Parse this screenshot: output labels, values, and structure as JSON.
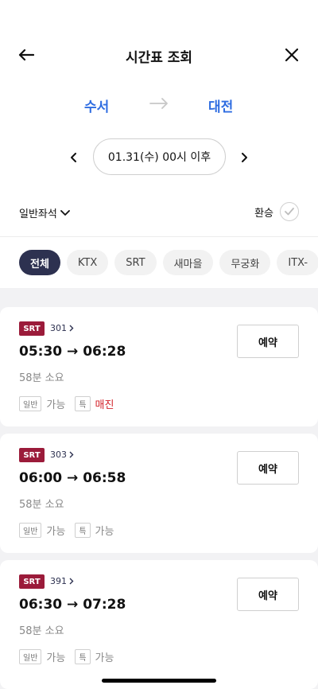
{
  "header": {
    "title": "시간표 조회"
  },
  "route": {
    "from": "수서",
    "to": "대전"
  },
  "date": {
    "label": "01.31(수) 00시 이후"
  },
  "filters": {
    "seat_class": "일반좌석",
    "transfer_label": "환승"
  },
  "train_types": [
    "전체",
    "KTX",
    "SRT",
    "새마을",
    "무궁화",
    "ITX-"
  ],
  "trains": [
    {
      "badge": "SRT",
      "number": "301",
      "times": "05:30 → 06:28",
      "duration": "58분 소요",
      "general_label": "일반",
      "general_status": "가능",
      "special_label": "특",
      "special_status": "매진",
      "reserve": "예약"
    },
    {
      "badge": "SRT",
      "number": "303",
      "times": "06:00 → 06:58",
      "duration": "58분 소요",
      "general_label": "일반",
      "general_status": "가능",
      "special_label": "특",
      "special_status": "가능",
      "reserve": "예약"
    },
    {
      "badge": "SRT",
      "number": "391",
      "times": "06:30 → 07:28",
      "duration": "58분 소요",
      "general_label": "일반",
      "general_status": "가능",
      "special_label": "특",
      "special_status": "가능",
      "reserve": "예약"
    }
  ],
  "colors": {
    "accent": "#2f6de1",
    "srt": "#9b1b3a",
    "chip_active": "#2d3150",
    "soldout": "#d3232a"
  }
}
